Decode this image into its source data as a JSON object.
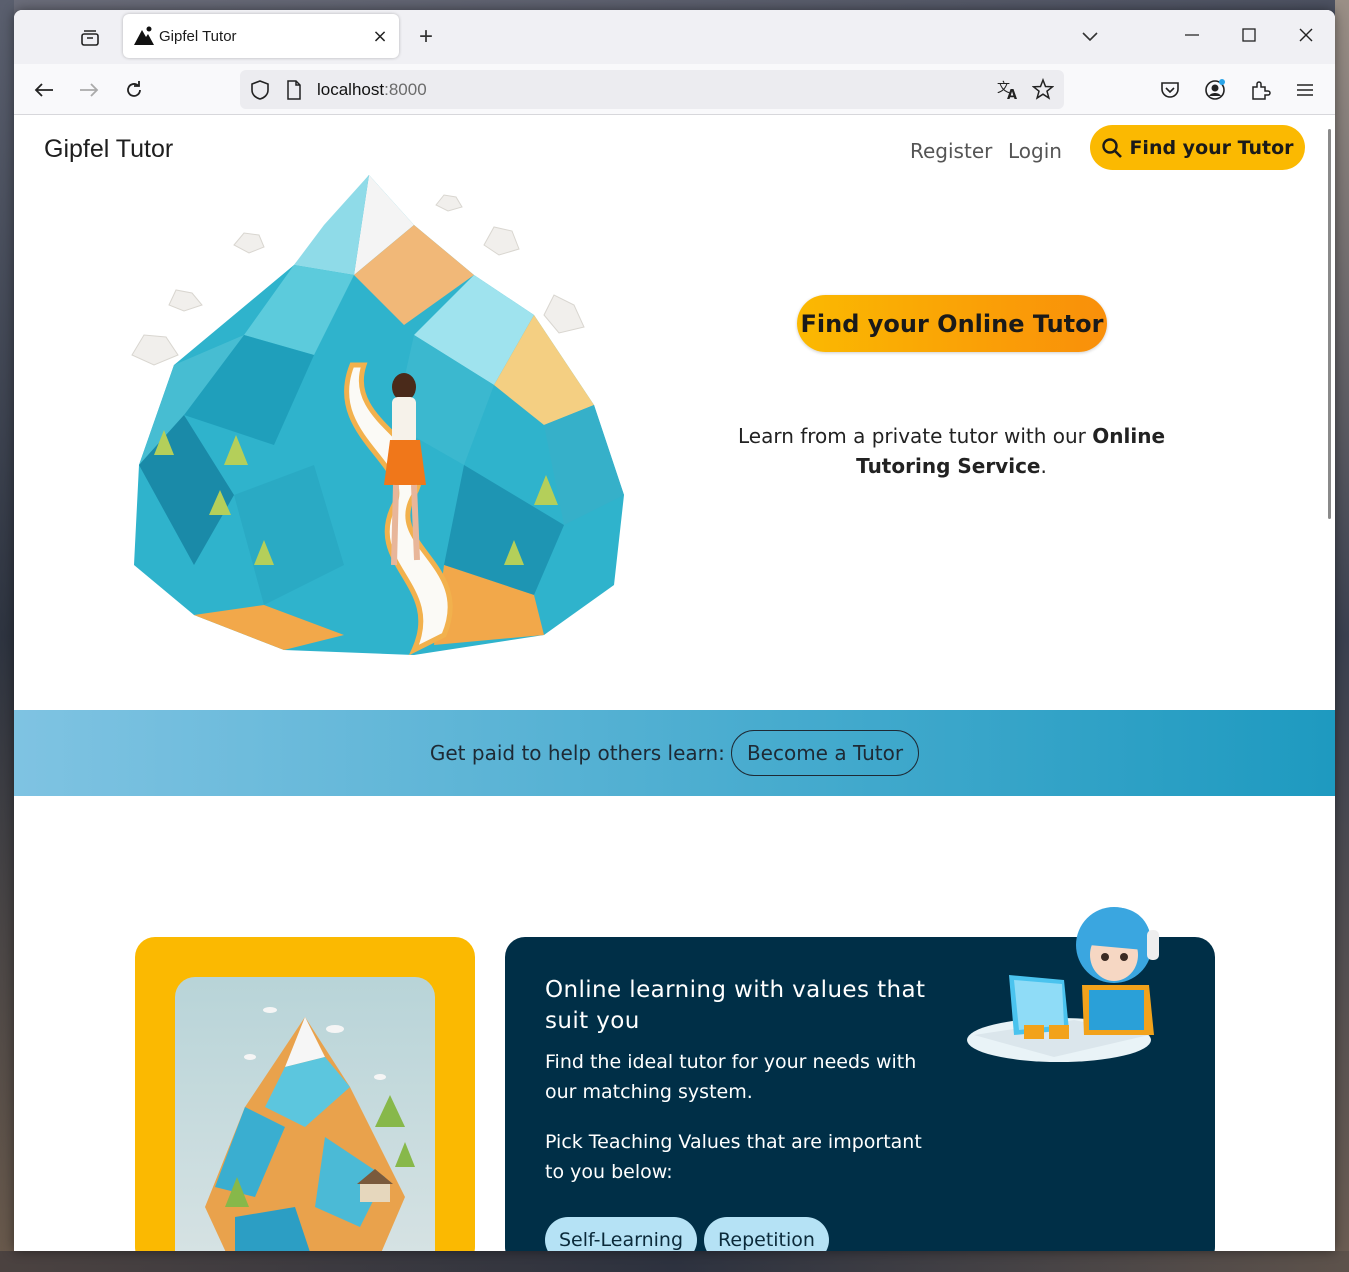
{
  "browser": {
    "tab_title": "Gipfel Tutor",
    "url_host": "localhost",
    "url_port": ":8000",
    "icons": {
      "tab_overview": "tab-overview-icon",
      "close_tab": "close-icon",
      "new_tab": "plus-icon",
      "tab_list": "chevron-down-icon",
      "minimize": "minimize-icon",
      "maximize": "maximize-icon",
      "close_window": "close-icon",
      "back": "back-arrow-icon",
      "forward": "forward-arrow-icon",
      "reload": "reload-icon",
      "shield": "shield-icon",
      "page": "page-icon",
      "translate": "translate-icon",
      "bookmark": "star-icon",
      "pocket": "pocket-icon",
      "account": "account-icon",
      "extensions": "puzzle-icon",
      "menu": "hamburger-menu-icon"
    },
    "new_tab_glyph": "+",
    "close_glyph": "×"
  },
  "nav": {
    "brand": "Gipfel Tutor",
    "register": "Register",
    "login": "Login",
    "cta": "Find your Tutor"
  },
  "hero": {
    "cta": "Find your Online Tutor",
    "text_before": "Learn from a private tutor with our ",
    "text_bold": "Online Tutoring Service",
    "text_after": "."
  },
  "tutor_band": {
    "label": "Get paid to help others learn:",
    "button": "Become a Tutor"
  },
  "values_card": {
    "heading": "Online learning with values that suit you",
    "p1": "Find the ideal tutor for your needs with our matching system.",
    "p2": "Pick Teaching Values that are important to you below:",
    "chips": [
      "Self-Learning",
      "Repetition"
    ]
  },
  "colors": {
    "accent": "#fbb901",
    "accent_orange": "#f98f0a",
    "band_start": "#7fc3e2",
    "band_end": "#1e9ac0",
    "dark_card": "#002f47",
    "chip": "#b5e2f5"
  }
}
